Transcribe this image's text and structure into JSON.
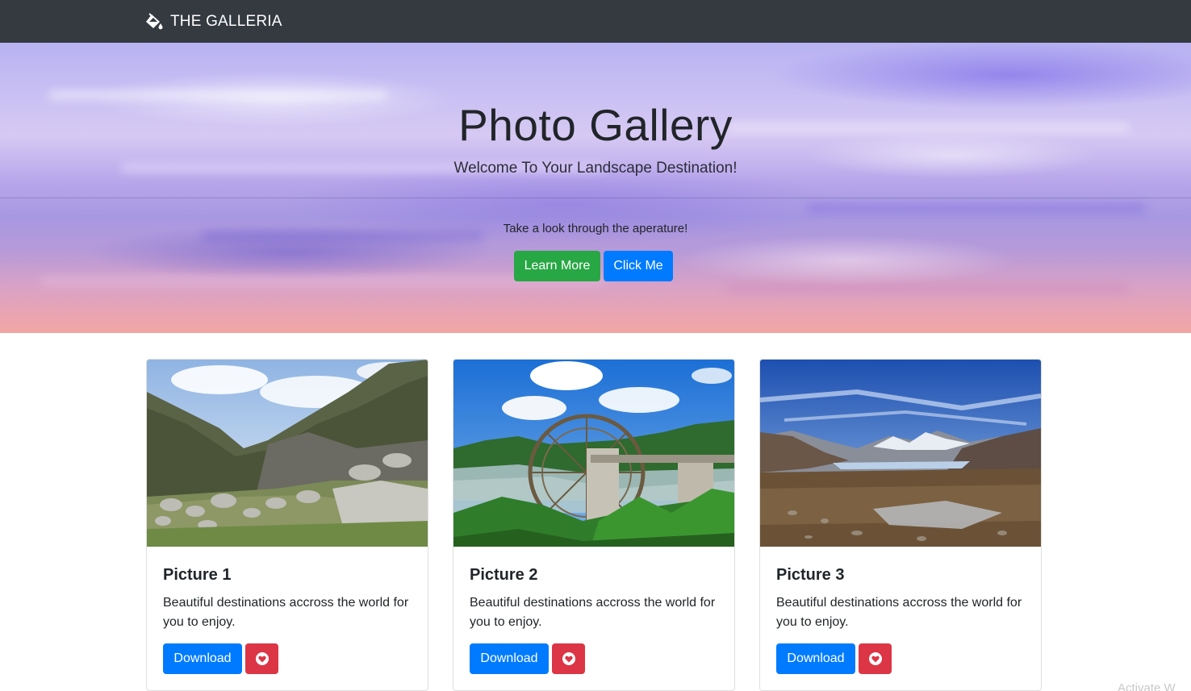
{
  "navbar": {
    "brand": "THE GALLERIA",
    "brand_icon": "paint-bucket-icon"
  },
  "hero": {
    "title": "Photo Gallery",
    "subtitle": "Welcome To Your Landscape Destination!",
    "lead": "Take a look through the aperature!",
    "learn_more_label": "Learn More",
    "click_me_label": "Click Me"
  },
  "cards": [
    {
      "title": "Picture 1",
      "text": "Beautiful destinations accross the world for you to enjoy.",
      "download_label": "Download",
      "like_icon": "heart-icon",
      "image": "rocky-mountain-valley-photo"
    },
    {
      "title": "Picture 2",
      "text": "Beautiful destinations accross the world for you to enjoy.",
      "download_label": "Download",
      "like_icon": "heart-icon",
      "image": "water-wheel-river-photo"
    },
    {
      "title": "Picture 3",
      "text": "Beautiful destinations accross the world for you to enjoy.",
      "download_label": "Download",
      "like_icon": "heart-icon",
      "image": "mountain-plateau-photo"
    }
  ],
  "watermark": "Activate W",
  "colors": {
    "navbar": "#343a40",
    "success": "#28a745",
    "primary": "#007bff",
    "danger": "#dc3545"
  }
}
